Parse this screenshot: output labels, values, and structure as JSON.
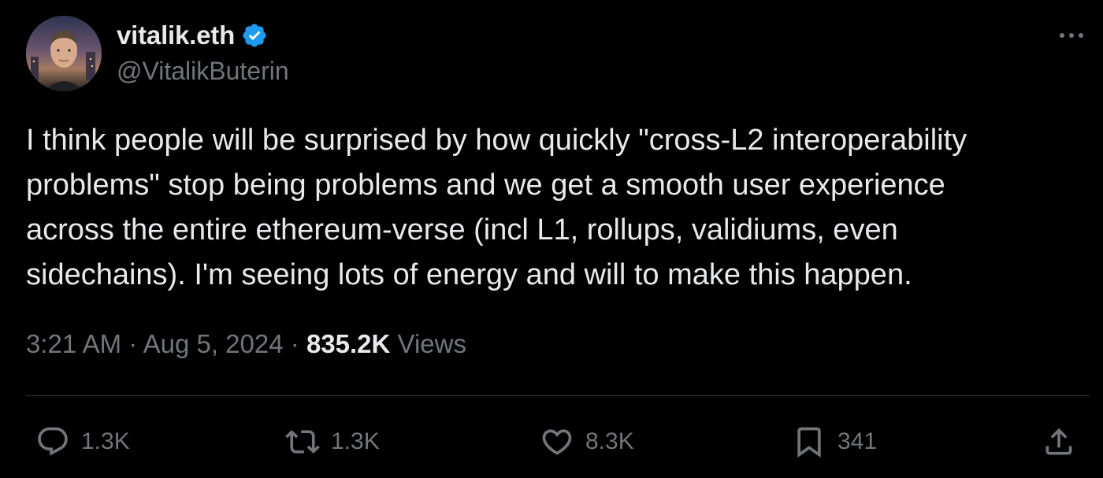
{
  "author": {
    "display_name": "vitalik.eth",
    "handle": "@VitalikButerin",
    "verified": true,
    "verified_color": "#1d9bf0"
  },
  "tweet": {
    "text_lines": [
      "I think people will be surprised by how quickly \"cross-L2 interoperability",
      "problems\" stop being problems and we get a smooth user experience",
      "across the entire ethereum-verse (incl L1, rollups, validiums, even",
      "sidechains). I'm seeing lots of energy and will to make this happen."
    ]
  },
  "meta": {
    "time": "3:21 AM",
    "separator": "·",
    "date": "Aug 5, 2024",
    "views_count": "835.2K",
    "views_label": "Views"
  },
  "actions": {
    "reply": {
      "icon": "reply-icon",
      "count": "1.3K"
    },
    "repost": {
      "icon": "repost-icon",
      "count": "1.3K"
    },
    "like": {
      "icon": "heart-icon",
      "count": "8.3K"
    },
    "bookmark": {
      "icon": "bookmark-icon",
      "count": "341"
    },
    "share": {
      "icon": "share-icon"
    }
  },
  "colors": {
    "background": "#000000",
    "primary_text": "#e7e9ea",
    "secondary_text": "#71767b",
    "divider": "#2f3336"
  }
}
